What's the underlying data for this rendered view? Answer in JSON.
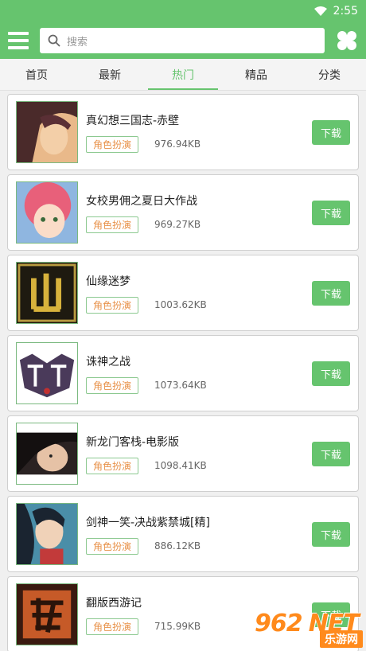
{
  "status": {
    "time": "2:55",
    "wifi_icon": "wifi-icon"
  },
  "header": {
    "menu_icon": "menu-icon",
    "search_placeholder": "搜索",
    "search_icon": "search-icon",
    "clover_icon": "clover-icon"
  },
  "tabs": [
    {
      "label": "首页"
    },
    {
      "label": "最新"
    },
    {
      "label": "热门",
      "active": true
    },
    {
      "label": "精品"
    },
    {
      "label": "分类"
    }
  ],
  "games": [
    {
      "title": "真幻想三国志-赤壁",
      "tag": "角色扮演",
      "size": "976.94KB",
      "button": "下载"
    },
    {
      "title": "女校男佣之夏日大作战",
      "tag": "角色扮演",
      "size": "969.27KB",
      "button": "下载"
    },
    {
      "title": "仙缘迷梦",
      "tag": "角色扮演",
      "size": "1003.62KB",
      "button": "下载"
    },
    {
      "title": "诛神之战",
      "tag": "角色扮演",
      "size": "1073.64KB",
      "button": "下载"
    },
    {
      "title": "新龙门客栈-电影版",
      "tag": "角色扮演",
      "size": "1098.41KB",
      "button": "下载"
    },
    {
      "title": "剑神一笑-决战紫禁城[精]",
      "tag": "角色扮演",
      "size": "886.12KB",
      "button": "下载"
    },
    {
      "title": "翻版西游记",
      "tag": "角色扮演",
      "size": "715.99KB",
      "button": "下载"
    }
  ],
  "watermark": {
    "main": "962",
    "dot": ".",
    "net": "NET",
    "sub": "乐游网"
  },
  "colors": {
    "accent": "#66c46e",
    "tag_text": "#e8924a",
    "watermark": "#ff8a1c"
  }
}
